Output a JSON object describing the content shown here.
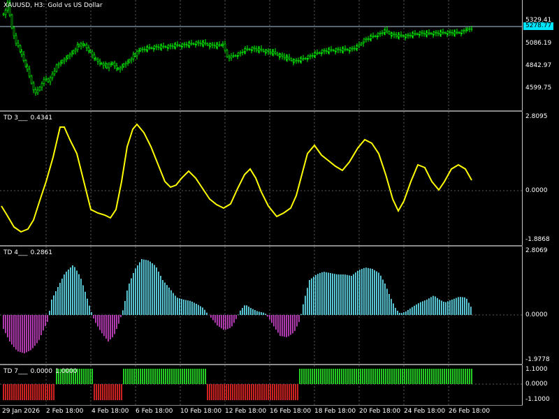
{
  "main": {
    "title_symbol": "XAUUSD, H3:",
    "title_desc": "Gold vs US Dollar",
    "yticks": [
      "5329.41",
      "5086.19",
      "4842.97",
      "4599.75"
    ],
    "current_price": "5278.77",
    "colors": {
      "bull": "#00ff00",
      "bear": "#00ff00",
      "hline": "#a8c8e0"
    }
  },
  "td3": {
    "name": "TD 3___",
    "value": "0.4341",
    "yticks": [
      "2.8095",
      "0.0000",
      "-1.8868"
    ],
    "color": "#ffff00"
  },
  "td4": {
    "name": "TD 4___",
    "value": "0.2861",
    "yticks": [
      "2.8069",
      "0.0000",
      "-1.9778"
    ],
    "colors": {
      "positive": "#5fd7e6",
      "negative": "#c040c0"
    }
  },
  "td7": {
    "name": "TD 7___",
    "value1": "0.0000",
    "value2": "1.0000",
    "yticks": [
      "1.1000",
      "0.0000",
      "-1.1000"
    ],
    "colors": {
      "positive": "#22cc22",
      "negative": "#cc2222"
    }
  },
  "xaxis": {
    "labels": [
      "29 Jan 2026",
      "2 Feb 18:00",
      "4 Feb 18:00",
      "6 Feb 18:00",
      "10 Feb 18:00",
      "12 Feb 18:00",
      "16 Feb 18:00",
      "18 Feb 18:00",
      "20 Feb 18:00",
      "24 Feb 18:00",
      "26 Feb 18:00"
    ]
  }
}
